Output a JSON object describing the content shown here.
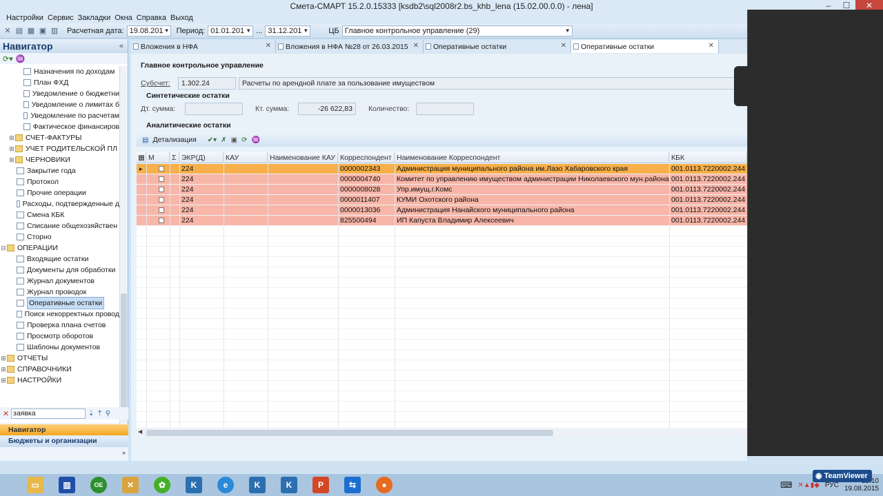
{
  "window": {
    "title": "Смета-СМАРТ 15.2.0.15333 [ksdb2\\sql2008r2.bs_khb_lena (15.02.00.0.0) - лена]"
  },
  "menu": [
    "Настройки",
    "Сервис",
    "Закладки",
    "Окна",
    "Справка",
    "Выход"
  ],
  "toolbar": {
    "calc_date_label": "Расчетная дата:",
    "calc_date_value": "19.08.201",
    "period_label": "Период:",
    "period_from": "01.01.201",
    "period_sep": "...",
    "period_to": "31.12.201",
    "cb_label": "ЦБ",
    "cb_value": "Главное контрольное управление (29)"
  },
  "navigator": {
    "title": "Навигатор",
    "items": [
      "Назначения по доходам",
      "План ФХД",
      "Уведомление о бюджетни",
      "Уведомление о лимитах б",
      "Уведомление по расчетам",
      "Фактическое финансиров",
      "СЧЕТ-ФАКТУРЫ",
      "УЧЕТ РОДИТЕЛЬСКОЙ ПЛ",
      "ЧЕРНОВИКИ",
      "Закрытие года",
      "Протокол",
      "Прочие операции",
      "Расходы, подтвержденные д",
      "Смена КБК",
      "Списание общехозяйствен",
      "Сторно",
      "ОПЕРАЦИИ",
      "Входящие остатки",
      "Документы для обработки",
      "Журнал документов",
      "Журнал проводок",
      "Оперативные остатки",
      "Поиск некорректных провод",
      "Проверка плана счетов",
      "Просмотр оборотов",
      "Шаблоны документов",
      "ОТЧЕТЫ",
      "СПРАВОЧНИКИ",
      "НАСТРОЙКИ"
    ],
    "search_value": "заявка",
    "panel_nav": "Навигатор",
    "panel_budget": "Бюджеты и организации"
  },
  "tabs": [
    "Вложения в НФА",
    "Вложения в НФА №28 от 26.03.2015",
    "Оперативные остатки",
    "Оперативные остатки"
  ],
  "content": {
    "org_title": "Главное контрольное управление",
    "subaccount_label": "Субсчет:",
    "subaccount_code": "1.302.24",
    "subaccount_name": "Расчеты по арендной плате за пользование имуществом",
    "synthetic_title": "Синтетические остатки",
    "debit_label": "Дт. сумма:",
    "debit_value": "",
    "credit_label": "Кт. сумма:",
    "credit_value": "-26 622,83",
    "qty_label": "Количество:",
    "qty_value": "",
    "analytic_title": "Аналитические остатки",
    "detail_button": "Детализация"
  },
  "grid": {
    "columns": [
      "М",
      "Σ",
      "ЭКР(Д)",
      "КАУ",
      "Наименование КАУ",
      "Корреспондент",
      "Наименование Корреспондент",
      "КБК"
    ],
    "rows": [
      {
        "ekr": "224",
        "kau": "",
        "kau_name": "",
        "corr": "0000002343",
        "corr_name": "Администрация муниципального района им.Лазо Хабаровского края",
        "kbk": "001.0113.7220002.244"
      },
      {
        "ekr": "224",
        "kau": "",
        "kau_name": "",
        "corr": "0000004740",
        "corr_name": "Комитет по управлению имуществом администрации Николаевского мун.района",
        "kbk": "001.0113.7220002.244"
      },
      {
        "ekr": "224",
        "kau": "",
        "kau_name": "",
        "corr": "0000008028",
        "corr_name": "Упр.имущ.г.Комс",
        "kbk": "001.0113.7220002.244"
      },
      {
        "ekr": "224",
        "kau": "",
        "kau_name": "",
        "corr": "0000011407",
        "corr_name": "КУМИ Охотского района",
        "kbk": "001.0113.7220002.244"
      },
      {
        "ekr": "224",
        "kau": "",
        "kau_name": "",
        "corr": "0000013036",
        "corr_name": "Администрация  Нанайского  муниципального района",
        "kbk": "001.0113.7220002.244"
      },
      {
        "ekr": "224",
        "kau": "",
        "kau_name": "",
        "corr": "825500494",
        "corr_name": "ИП Капуста Владимир Алексеевич",
        "kbk": "001.0113.7220002.244"
      }
    ]
  },
  "taskbar": {
    "lang": "РУС",
    "time": "15:10",
    "date": "19.08.2015",
    "teamviewer": "TeamViewer"
  },
  "colors": {
    "selected_row": "#f7b04a",
    "row": "#f7b6a8",
    "nav_active": "#f5a623"
  }
}
